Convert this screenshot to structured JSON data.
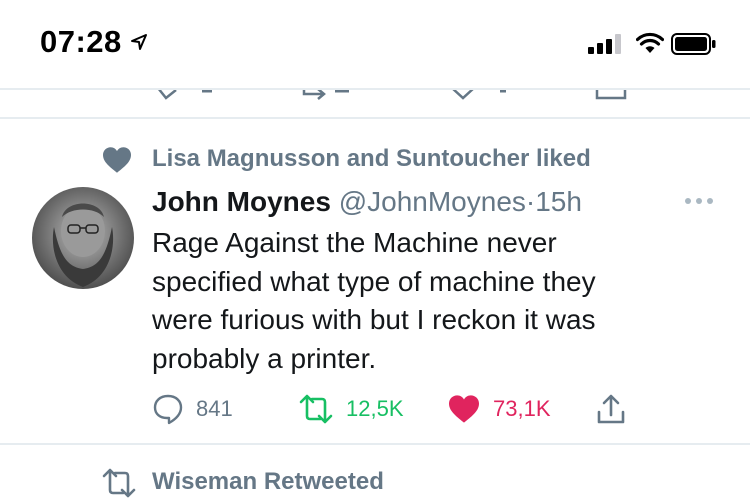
{
  "status_bar": {
    "time": "07:28",
    "icons": [
      "location-arrow-icon",
      "signal-icon",
      "wifi-icon",
      "battery-icon"
    ]
  },
  "tweet": {
    "social_context": "Lisa Magnusson and Suntoucher liked",
    "display_name": "John Moynes",
    "handle": "@JohnMoynes",
    "separator": "·",
    "time_ago": "15h",
    "text_lines": [
      "Rage Against the Machine never",
      "specified what type of machine they",
      "were furious with but I reckon it was",
      "probably a printer."
    ],
    "replies": "841",
    "retweets": "12,5K",
    "likes": "73,1K"
  },
  "next_tweet": {
    "social_context": "Wiseman Retweeted"
  },
  "colors": {
    "secondary_text": "#657786",
    "retweet_green": "#17bf63",
    "like_red": "#e0245e",
    "divider": "#e6ecf0"
  }
}
